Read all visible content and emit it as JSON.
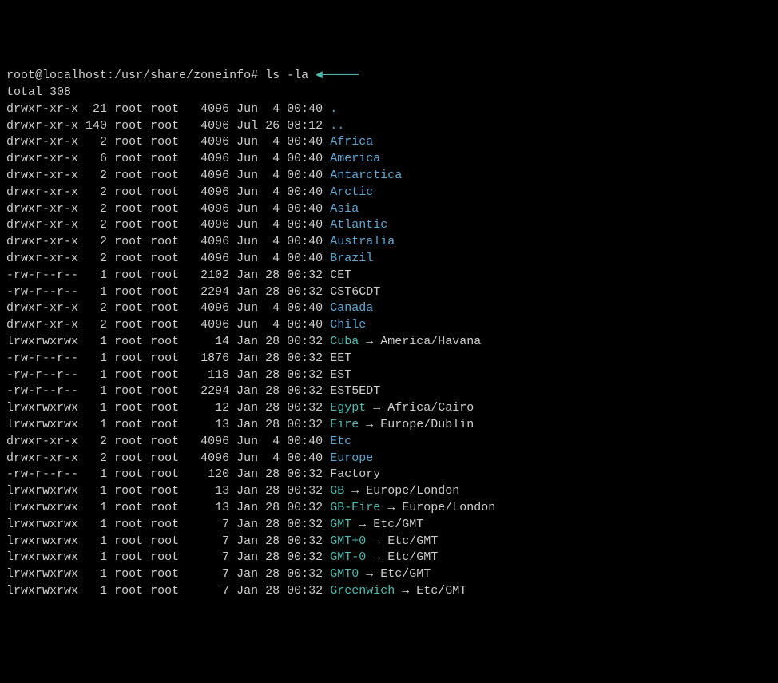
{
  "prompt": {
    "user_host": "root@localhost",
    "path": "/usr/share/zoneinfo",
    "separator": ":",
    "hash": "#",
    "command": "ls -la",
    "annotation_arrow": "◄─────"
  },
  "total_line": "total 308",
  "entries": [
    {
      "perms": "drwxr-xr-x",
      "links": " 21",
      "owner": "root",
      "group": "root",
      "size": "  4096",
      "date": "Jun  4 00:40",
      "name": ".",
      "type": "dir",
      "target": ""
    },
    {
      "perms": "drwxr-xr-x",
      "links": "140",
      "owner": "root",
      "group": "root",
      "size": "  4096",
      "date": "Jul 26 08:12",
      "name": "..",
      "type": "dir",
      "target": ""
    },
    {
      "perms": "drwxr-xr-x",
      "links": "  2",
      "owner": "root",
      "group": "root",
      "size": "  4096",
      "date": "Jun  4 00:40",
      "name": "Africa",
      "type": "dir",
      "target": ""
    },
    {
      "perms": "drwxr-xr-x",
      "links": "  6",
      "owner": "root",
      "group": "root",
      "size": "  4096",
      "date": "Jun  4 00:40",
      "name": "America",
      "type": "dir",
      "target": ""
    },
    {
      "perms": "drwxr-xr-x",
      "links": "  2",
      "owner": "root",
      "group": "root",
      "size": "  4096",
      "date": "Jun  4 00:40",
      "name": "Antarctica",
      "type": "dir",
      "target": ""
    },
    {
      "perms": "drwxr-xr-x",
      "links": "  2",
      "owner": "root",
      "group": "root",
      "size": "  4096",
      "date": "Jun  4 00:40",
      "name": "Arctic",
      "type": "dir",
      "target": ""
    },
    {
      "perms": "drwxr-xr-x",
      "links": "  2",
      "owner": "root",
      "group": "root",
      "size": "  4096",
      "date": "Jun  4 00:40",
      "name": "Asia",
      "type": "dir",
      "target": ""
    },
    {
      "perms": "drwxr-xr-x",
      "links": "  2",
      "owner": "root",
      "group": "root",
      "size": "  4096",
      "date": "Jun  4 00:40",
      "name": "Atlantic",
      "type": "dir",
      "target": ""
    },
    {
      "perms": "drwxr-xr-x",
      "links": "  2",
      "owner": "root",
      "group": "root",
      "size": "  4096",
      "date": "Jun  4 00:40",
      "name": "Australia",
      "type": "dir",
      "target": ""
    },
    {
      "perms": "drwxr-xr-x",
      "links": "  2",
      "owner": "root",
      "group": "root",
      "size": "  4096",
      "date": "Jun  4 00:40",
      "name": "Brazil",
      "type": "dir",
      "target": ""
    },
    {
      "perms": "-rw-r--r--",
      "links": "  1",
      "owner": "root",
      "group": "root",
      "size": "  2102",
      "date": "Jan 28 00:32",
      "name": "CET",
      "type": "file",
      "target": ""
    },
    {
      "perms": "-rw-r--r--",
      "links": "  1",
      "owner": "root",
      "group": "root",
      "size": "  2294",
      "date": "Jan 28 00:32",
      "name": "CST6CDT",
      "type": "file",
      "target": ""
    },
    {
      "perms": "drwxr-xr-x",
      "links": "  2",
      "owner": "root",
      "group": "root",
      "size": "  4096",
      "date": "Jun  4 00:40",
      "name": "Canada",
      "type": "dir",
      "target": ""
    },
    {
      "perms": "drwxr-xr-x",
      "links": "  2",
      "owner": "root",
      "group": "root",
      "size": "  4096",
      "date": "Jun  4 00:40",
      "name": "Chile",
      "type": "dir",
      "target": ""
    },
    {
      "perms": "lrwxrwxrwx",
      "links": "  1",
      "owner": "root",
      "group": "root",
      "size": "    14",
      "date": "Jan 28 00:32",
      "name": "Cuba",
      "type": "link",
      "target": "America/Havana"
    },
    {
      "perms": "-rw-r--r--",
      "links": "  1",
      "owner": "root",
      "group": "root",
      "size": "  1876",
      "date": "Jan 28 00:32",
      "name": "EET",
      "type": "file",
      "target": ""
    },
    {
      "perms": "-rw-r--r--",
      "links": "  1",
      "owner": "root",
      "group": "root",
      "size": "   118",
      "date": "Jan 28 00:32",
      "name": "EST",
      "type": "file",
      "target": ""
    },
    {
      "perms": "-rw-r--r--",
      "links": "  1",
      "owner": "root",
      "group": "root",
      "size": "  2294",
      "date": "Jan 28 00:32",
      "name": "EST5EDT",
      "type": "file",
      "target": ""
    },
    {
      "perms": "lrwxrwxrwx",
      "links": "  1",
      "owner": "root",
      "group": "root",
      "size": "    12",
      "date": "Jan 28 00:32",
      "name": "Egypt",
      "type": "link",
      "target": "Africa/Cairo"
    },
    {
      "perms": "lrwxrwxrwx",
      "links": "  1",
      "owner": "root",
      "group": "root",
      "size": "    13",
      "date": "Jan 28 00:32",
      "name": "Eire",
      "type": "link",
      "target": "Europe/Dublin"
    },
    {
      "perms": "drwxr-xr-x",
      "links": "  2",
      "owner": "root",
      "group": "root",
      "size": "  4096",
      "date": "Jun  4 00:40",
      "name": "Etc",
      "type": "dir",
      "target": ""
    },
    {
      "perms": "drwxr-xr-x",
      "links": "  2",
      "owner": "root",
      "group": "root",
      "size": "  4096",
      "date": "Jun  4 00:40",
      "name": "Europe",
      "type": "dir",
      "target": ""
    },
    {
      "perms": "-rw-r--r--",
      "links": "  1",
      "owner": "root",
      "group": "root",
      "size": "   120",
      "date": "Jan 28 00:32",
      "name": "Factory",
      "type": "file",
      "target": ""
    },
    {
      "perms": "lrwxrwxrwx",
      "links": "  1",
      "owner": "root",
      "group": "root",
      "size": "    13",
      "date": "Jan 28 00:32",
      "name": "GB",
      "type": "link",
      "target": "Europe/London"
    },
    {
      "perms": "lrwxrwxrwx",
      "links": "  1",
      "owner": "root",
      "group": "root",
      "size": "    13",
      "date": "Jan 28 00:32",
      "name": "GB-Eire",
      "type": "link",
      "target": "Europe/London"
    },
    {
      "perms": "lrwxrwxrwx",
      "links": "  1",
      "owner": "root",
      "group": "root",
      "size": "     7",
      "date": "Jan 28 00:32",
      "name": "GMT",
      "type": "link",
      "target": "Etc/GMT"
    },
    {
      "perms": "lrwxrwxrwx",
      "links": "  1",
      "owner": "root",
      "group": "root",
      "size": "     7",
      "date": "Jan 28 00:32",
      "name": "GMT+0",
      "type": "link",
      "target": "Etc/GMT"
    },
    {
      "perms": "lrwxrwxrwx",
      "links": "  1",
      "owner": "root",
      "group": "root",
      "size": "     7",
      "date": "Jan 28 00:32",
      "name": "GMT-0",
      "type": "link",
      "target": "Etc/GMT"
    },
    {
      "perms": "lrwxrwxrwx",
      "links": "  1",
      "owner": "root",
      "group": "root",
      "size": "     7",
      "date": "Jan 28 00:32",
      "name": "GMT0",
      "type": "link",
      "target": "Etc/GMT"
    },
    {
      "perms": "lrwxrwxrwx",
      "links": "  1",
      "owner": "root",
      "group": "root",
      "size": "     7",
      "date": "Jan 28 00:32",
      "name": "Greenwich",
      "type": "link",
      "target": "Etc/GMT"
    }
  ],
  "link_arrow": " → "
}
